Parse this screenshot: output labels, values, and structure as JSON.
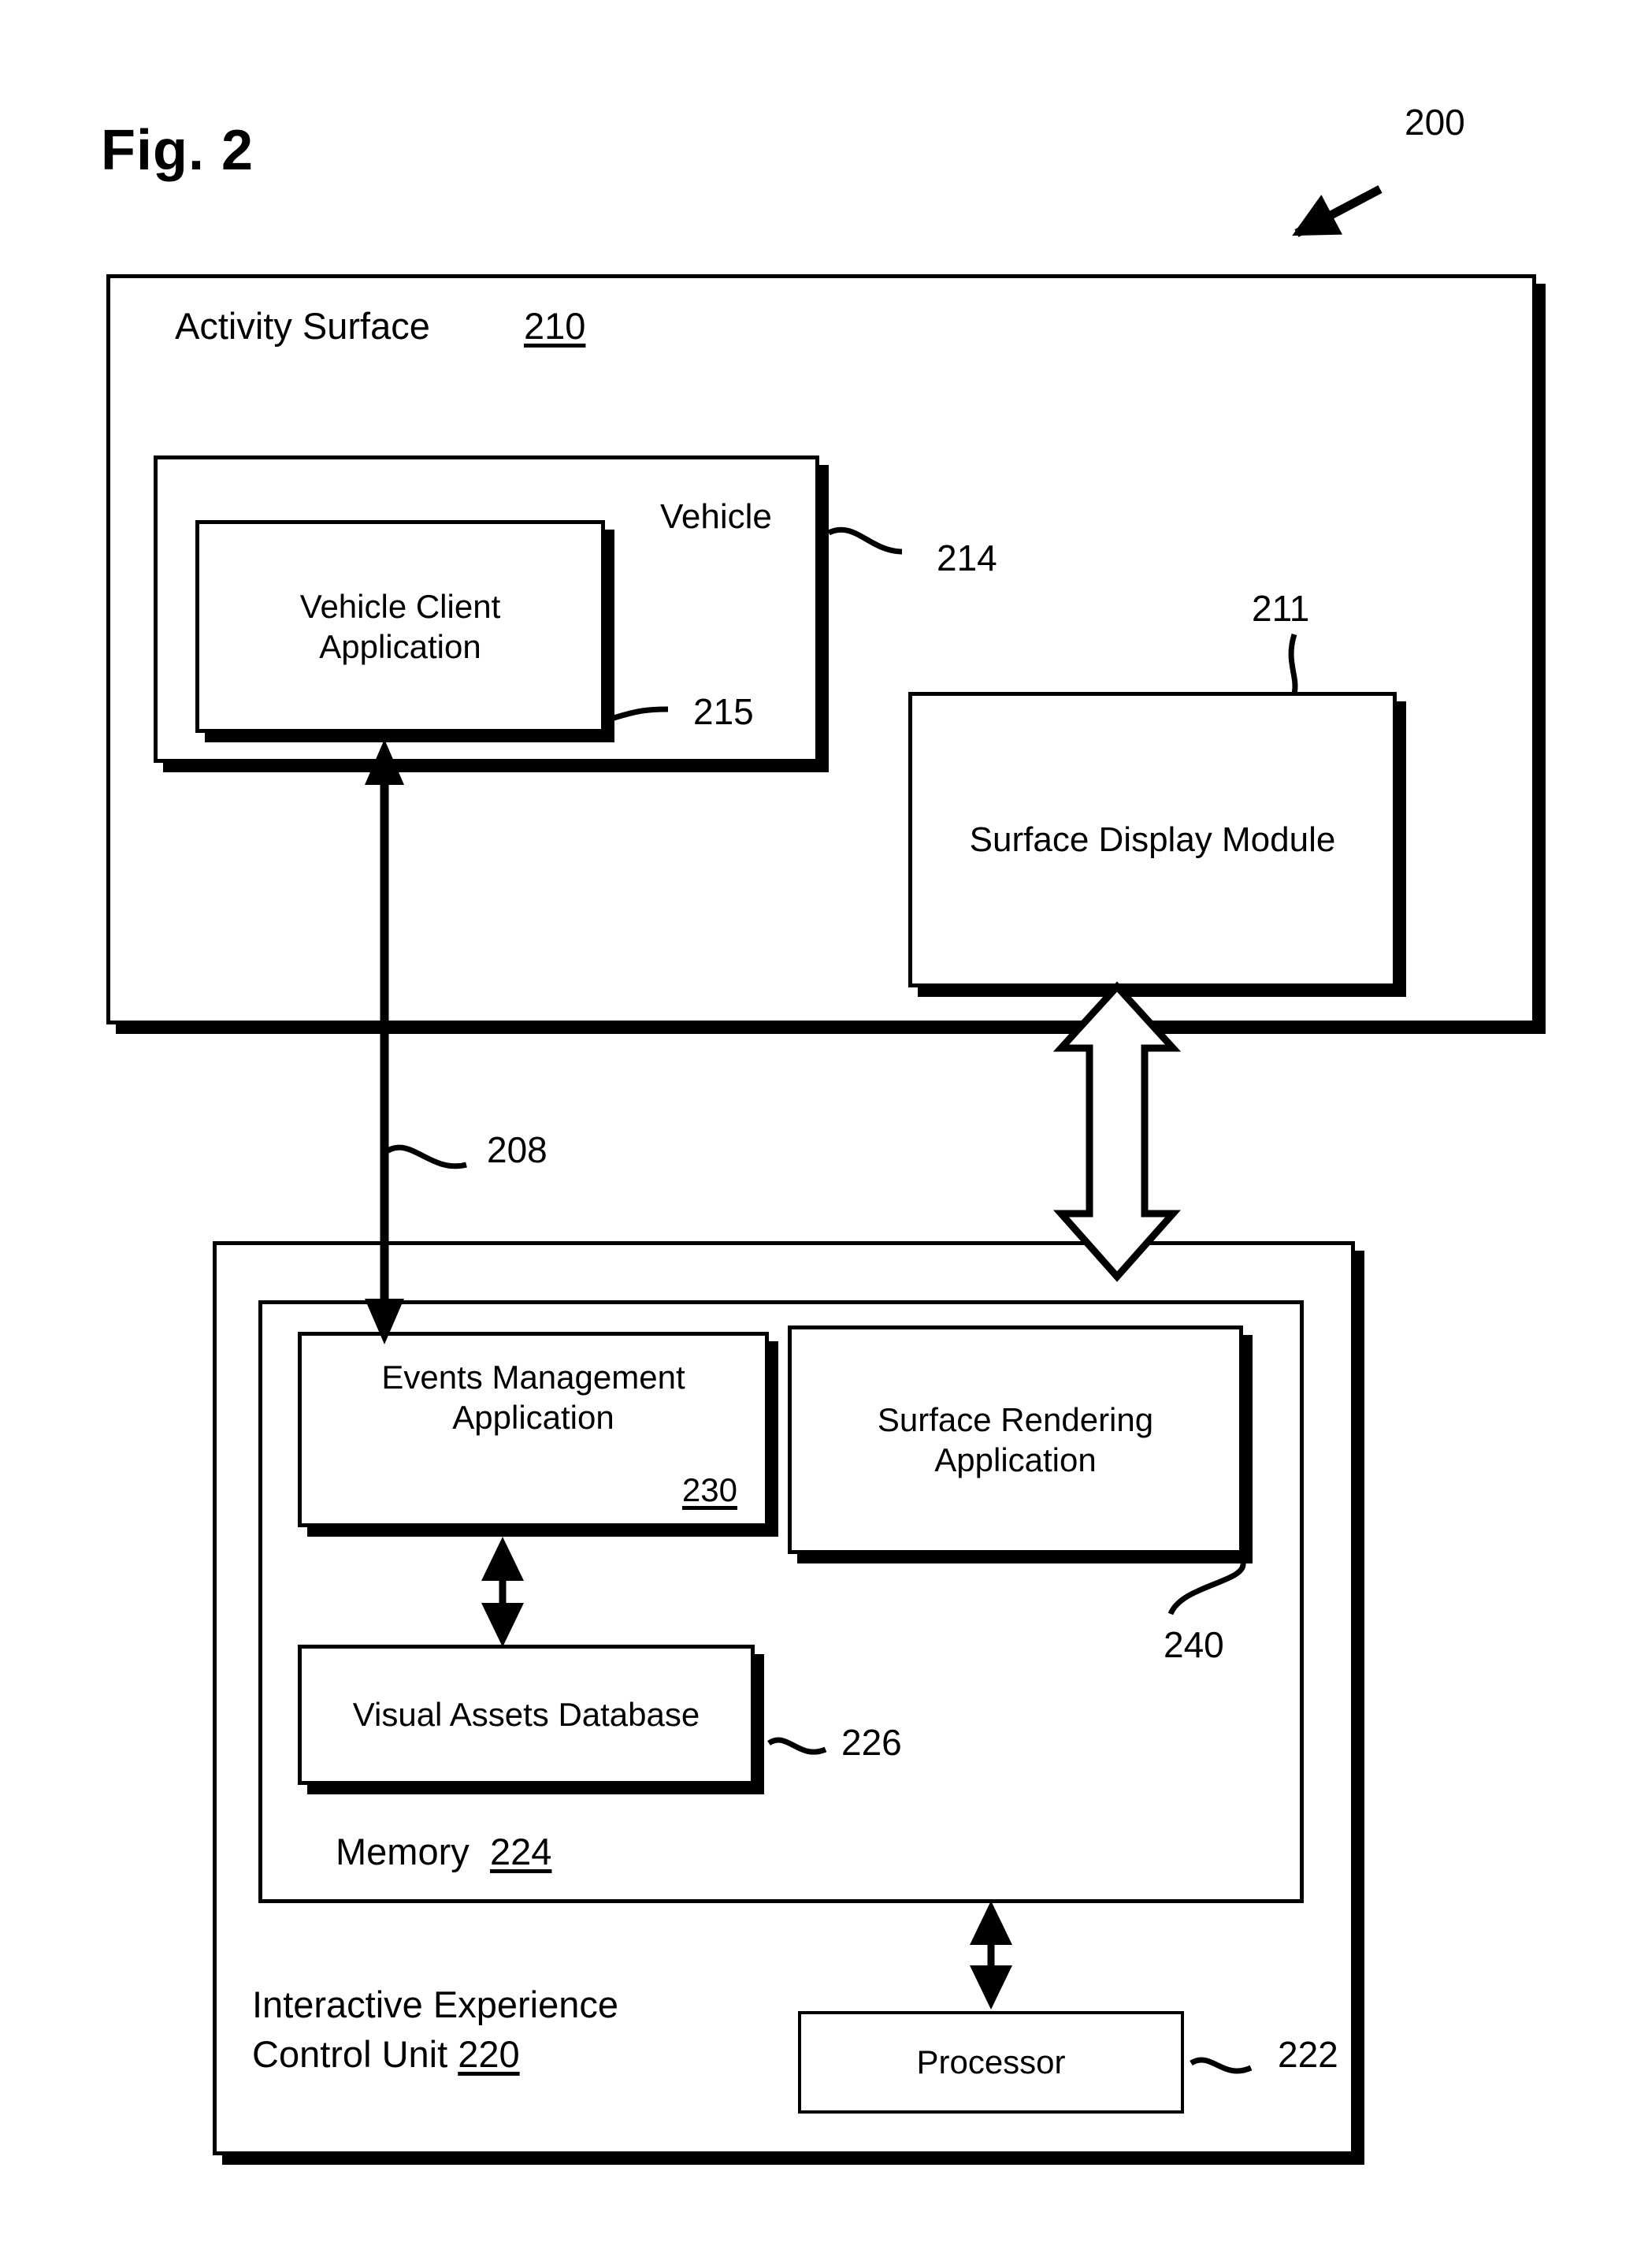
{
  "figure": {
    "title": "Fig. 2",
    "system_ref": "200"
  },
  "activity_surface": {
    "label": "Activity Surface",
    "ref": "210",
    "vehicle": {
      "label": "Vehicle",
      "ref": "214",
      "client_application": {
        "label": "Vehicle Client\nApplication",
        "line1": "Vehicle Client",
        "line2": "Application",
        "ref": "215"
      }
    },
    "surface_display_module": {
      "label": "Surface Display Module",
      "ref": "211"
    }
  },
  "connections": {
    "vehicle_to_events_ref": "208"
  },
  "control_unit": {
    "label_line1": "Interactive Experience",
    "label_line2": "Control Unit",
    "ref": "220",
    "memory": {
      "label": "Memory",
      "ref": "224",
      "events_management_application": {
        "line1": "Events Management",
        "line2": "Application",
        "ref": "230"
      },
      "surface_rendering_application": {
        "line1": "Surface Rendering",
        "line2": "Application",
        "ref": "240"
      },
      "visual_assets_database": {
        "label": "Visual Assets Database",
        "ref": "226"
      }
    },
    "processor": {
      "label": "Processor",
      "ref": "222"
    }
  },
  "colors": {
    "ink": "#000000",
    "paper": "#ffffff"
  }
}
